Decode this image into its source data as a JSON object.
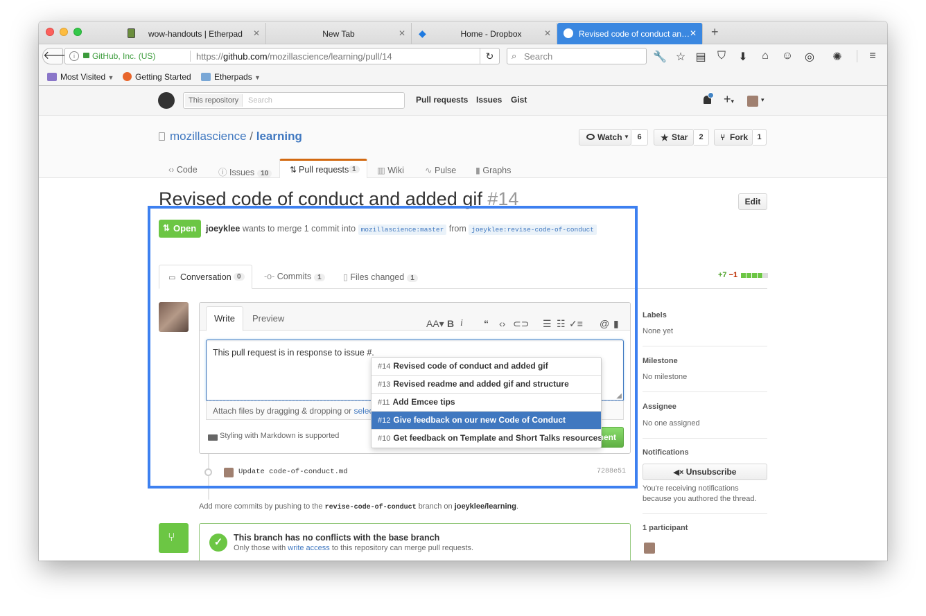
{
  "browser": {
    "tabs": [
      {
        "title": "wow-handouts | Etherpad",
        "close": "✕"
      },
      {
        "title": "New Tab",
        "close": "✕"
      },
      {
        "title": "Home - Dropbox",
        "close": "✕"
      },
      {
        "title": "Revised code of conduct an…",
        "close": "✕"
      }
    ],
    "new_tab": "+",
    "identity": "GitHub, Inc. (US)",
    "url_prefix": "https://",
    "url_domain": "github.com",
    "url_path": "/mozillascience/learning/pull/14",
    "search_placeholder": "Search",
    "bookmarks": [
      "Most Visited",
      "Getting Started",
      "Etherpads"
    ]
  },
  "gh_header": {
    "scope_label": "This repository",
    "search_placeholder": "Search",
    "nav": [
      "Pull requests",
      "Issues",
      "Gist"
    ],
    "plus": "+",
    "caret": "▾"
  },
  "repo": {
    "owner": "mozillascience",
    "separator": "/",
    "name": "learning",
    "watch_label": "Watch",
    "watch_count": "6",
    "star_label": "Star",
    "star_count": "2",
    "fork_label": "Fork",
    "fork_count": "1",
    "nav": {
      "code": "Code",
      "issues": "Issues",
      "issues_count": "10",
      "pulls": "Pull requests",
      "pulls_count": "1",
      "wiki": "Wiki",
      "pulse": "Pulse",
      "graphs": "Graphs"
    }
  },
  "pr": {
    "title": "Revised code of conduct and added gif",
    "number": "#14",
    "edit_label": "Edit",
    "state": "Open",
    "author": "joeyklee",
    "merge_text": "wants to merge 1 commit into",
    "base_branch": "mozillascience:master",
    "from_text": "from",
    "head_branch": "joeyklee:revise-code-of-conduct",
    "tabs": {
      "conversation": "Conversation",
      "conversation_count": "0",
      "commits": "Commits",
      "commits_count": "1",
      "files": "Files changed",
      "files_count": "1"
    },
    "diffstat_add": "+7",
    "diffstat_del": "−1"
  },
  "comment": {
    "write_tab": "Write",
    "preview_tab": "Preview",
    "text": "This pull request is in response to issue #.",
    "attach_text": "Attach files by dragging & dropping or ",
    "attach_link": "select",
    "markdown_note": "Styling with Markdown is supported",
    "submit_label": "nent",
    "suggestions": [
      {
        "num": "#14",
        "title": "Revised code of conduct and added gif"
      },
      {
        "num": "#13",
        "title": "Revised readme and added gif and structure"
      },
      {
        "num": "#11",
        "title": "Add Emcee tips"
      },
      {
        "num": "#12",
        "title": "Give feedback on our new Code of Conduct"
      },
      {
        "num": "#10",
        "title": "Get feedback on Template and Short Talks resources"
      }
    ]
  },
  "commit": {
    "message": "Update code-of-conduct.md",
    "sha": "7288e51"
  },
  "push_note": {
    "before": "Add more commits by pushing to the ",
    "branch": "revise-code-of-conduct",
    "middle": " branch on ",
    "repo": "joeyklee/learning",
    "after": "."
  },
  "merge_box": {
    "title": "This branch has no conflicts with the base branch",
    "before": "Only those with ",
    "link": "write access",
    "after": " to this repository can merge pull requests."
  },
  "sidebar": {
    "labels_heading": "Labels",
    "labels_value": "None yet",
    "milestone_heading": "Milestone",
    "milestone_value": "No milestone",
    "assignee_heading": "Assignee",
    "assignee_value": "No one assigned",
    "notifications_heading": "Notifications",
    "unsubscribe_label": "Unsubscribe",
    "notifications_line1": "You're receiving notifications",
    "notifications_line2": "because you authored the thread.",
    "participants_heading": "1 participant"
  },
  "colors": {
    "highlight_border": "#3d80f0",
    "open_green": "#6cc644",
    "link_blue": "#4078c0",
    "selected_row": "#4078c0",
    "active_tab": "#3a87e0"
  }
}
